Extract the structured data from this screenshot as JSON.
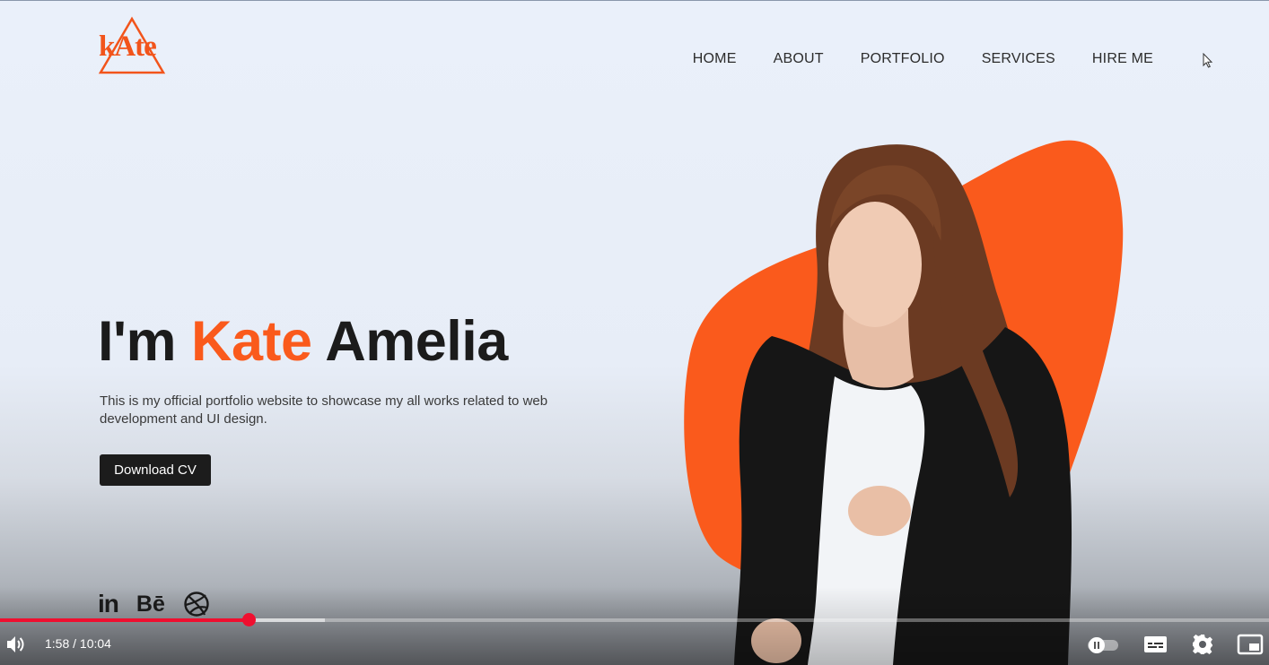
{
  "logo": {
    "text": "kAte"
  },
  "nav": {
    "items": [
      {
        "label": "HOME"
      },
      {
        "label": "ABOUT"
      },
      {
        "label": "PORTFOLIO"
      },
      {
        "label": "SERVICES"
      },
      {
        "label": "HIRE ME"
      }
    ]
  },
  "hero": {
    "title_prefix": "I'm ",
    "title_accent": "Kate",
    "title_suffix": " Amelia",
    "description": "This is my official portfolio website to showcase my all works related to web development and UI design.",
    "button_label": "Download CV"
  },
  "social": {
    "linkedin": "in",
    "behance": "Bē",
    "dribbble_icon": "dribbble-icon"
  },
  "player": {
    "time_display": "1:58 / 10:04",
    "progress_fraction": 0.196,
    "buffered_fraction": 0.256
  },
  "colors": {
    "accent": "#fa5a1c",
    "progress": "#f00f2f",
    "button_bg": "#1c1c1c"
  }
}
